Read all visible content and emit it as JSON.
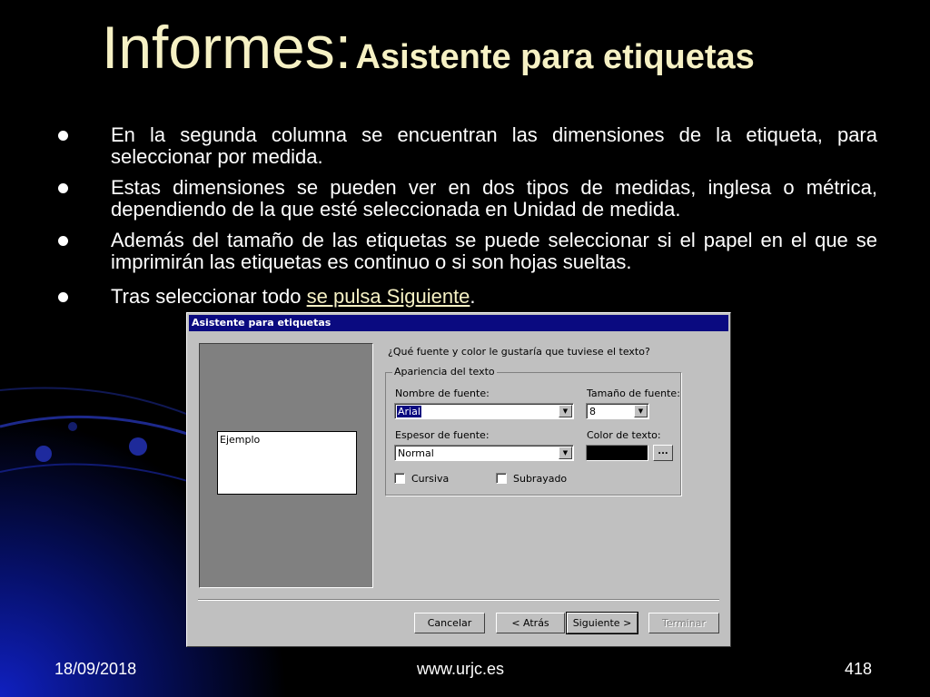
{
  "slide": {
    "title_main": "Informes:",
    "title_sub": "Asistente para etiquetas",
    "bullets": [
      "En la segunda columna se encuentran las dimensiones de la etiqueta, para seleccionar por medida.",
      "Estas dimensiones se pueden ver en dos tipos de medidas, inglesa o métrica, dependiendo de la que esté seleccionada en Unidad de medida.",
      "Además del tamaño de las etiquetas se puede seleccionar si el papel en el que se imprimirán las etiquetas es continuo o si son hojas sueltas."
    ],
    "last_bullet_prefix": "Tras seleccionar todo ",
    "last_bullet_highlight": "se pulsa Siguiente",
    "last_bullet_suffix": "."
  },
  "dialog": {
    "title": "Asistente para etiquetas",
    "preview_text": "Ejemplo",
    "question": "¿Qué fuente y color le gustaría que tuviese el texto?",
    "group_label": "Apariencia del texto",
    "font_name_label": "Nombre de fuente:",
    "font_name_value": "Arial",
    "font_size_label": "Tamaño de fuente:",
    "font_size_value": "8",
    "font_weight_label": "Espesor de fuente:",
    "font_weight_value": "Normal",
    "text_color_label": "Color de texto:",
    "text_color_value": "#000000",
    "color_button_label": "...",
    "italic_label": "Cursiva",
    "italic_checked": false,
    "underline_label": "Subrayado",
    "underline_checked": false,
    "buttons": {
      "cancel": "Cancelar",
      "back": "< Atrás",
      "next": "Siguiente >",
      "finish": "Terminar"
    }
  },
  "footer": {
    "date": "18/09/2018",
    "url": "www.urjc.es",
    "page": "418"
  }
}
